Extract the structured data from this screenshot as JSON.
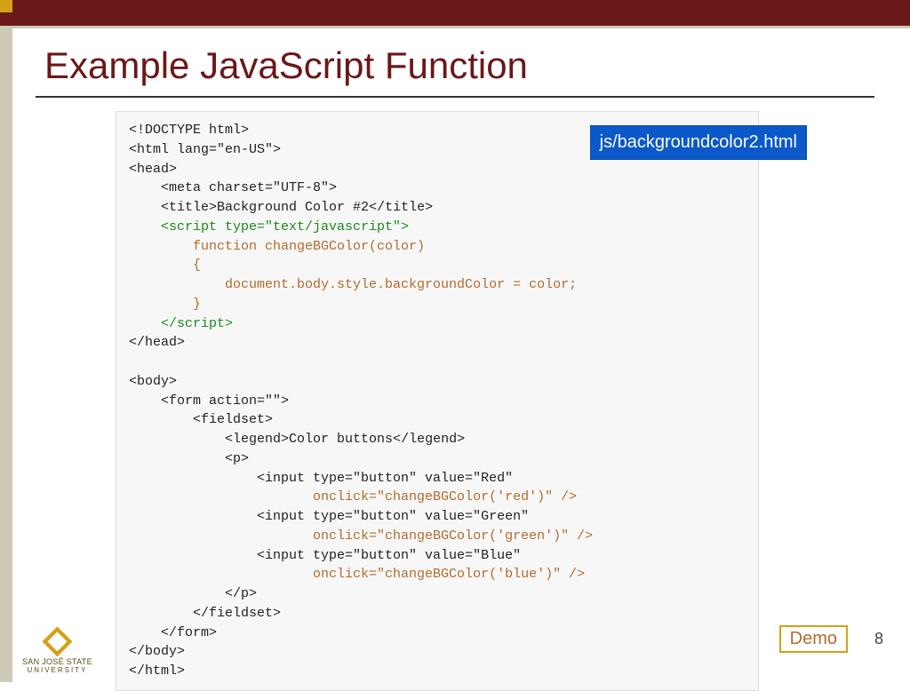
{
  "slide": {
    "title": "Example JavaScript Function",
    "page_number": "8",
    "demo_label": "Demo",
    "file_label": "js/backgroundcolor2.html"
  },
  "code": {
    "l01": "<!DOCTYPE html>",
    "l02": "<html lang=\"en-US\">",
    "l03": "<head>",
    "l04": "    <meta charset=\"UTF-8\">",
    "l05a": "    <title>",
    "l05b": "Background Color #2",
    "l05c": "</title>",
    "l06": "    <script type=\"text/javascript\">",
    "l07": "        function changeBGColor(color)",
    "l08": "        {",
    "l09": "            document.body.style.backgroundColor = color;",
    "l10": "        }",
    "l11": "    </script>",
    "l12": "</head>",
    "l13": "",
    "l14": "<body>",
    "l15": "    <form action=\"\">",
    "l16": "        <fieldset>",
    "l17a": "            <legend>",
    "l17b": "Color buttons",
    "l17c": "</legend>",
    "l18": "            <p>",
    "l19": "                <input type=\"button\" value=\"Red\"",
    "l20": "                       onclick=\"changeBGColor('red')\" />",
    "l21": "                <input type=\"button\" value=\"Green\"",
    "l22": "                       onclick=\"changeBGColor('green')\" />",
    "l23": "                <input type=\"button\" value=\"Blue\"",
    "l24": "                       onclick=\"changeBGColor('blue')\" />",
    "l25": "            </p>",
    "l26": "        </fieldset>",
    "l27": "    </form>",
    "l28": "</body>",
    "l29": "</html>"
  },
  "logo": {
    "line1": "SAN JOSÉ STATE",
    "line2": "UNIVERSITY"
  }
}
